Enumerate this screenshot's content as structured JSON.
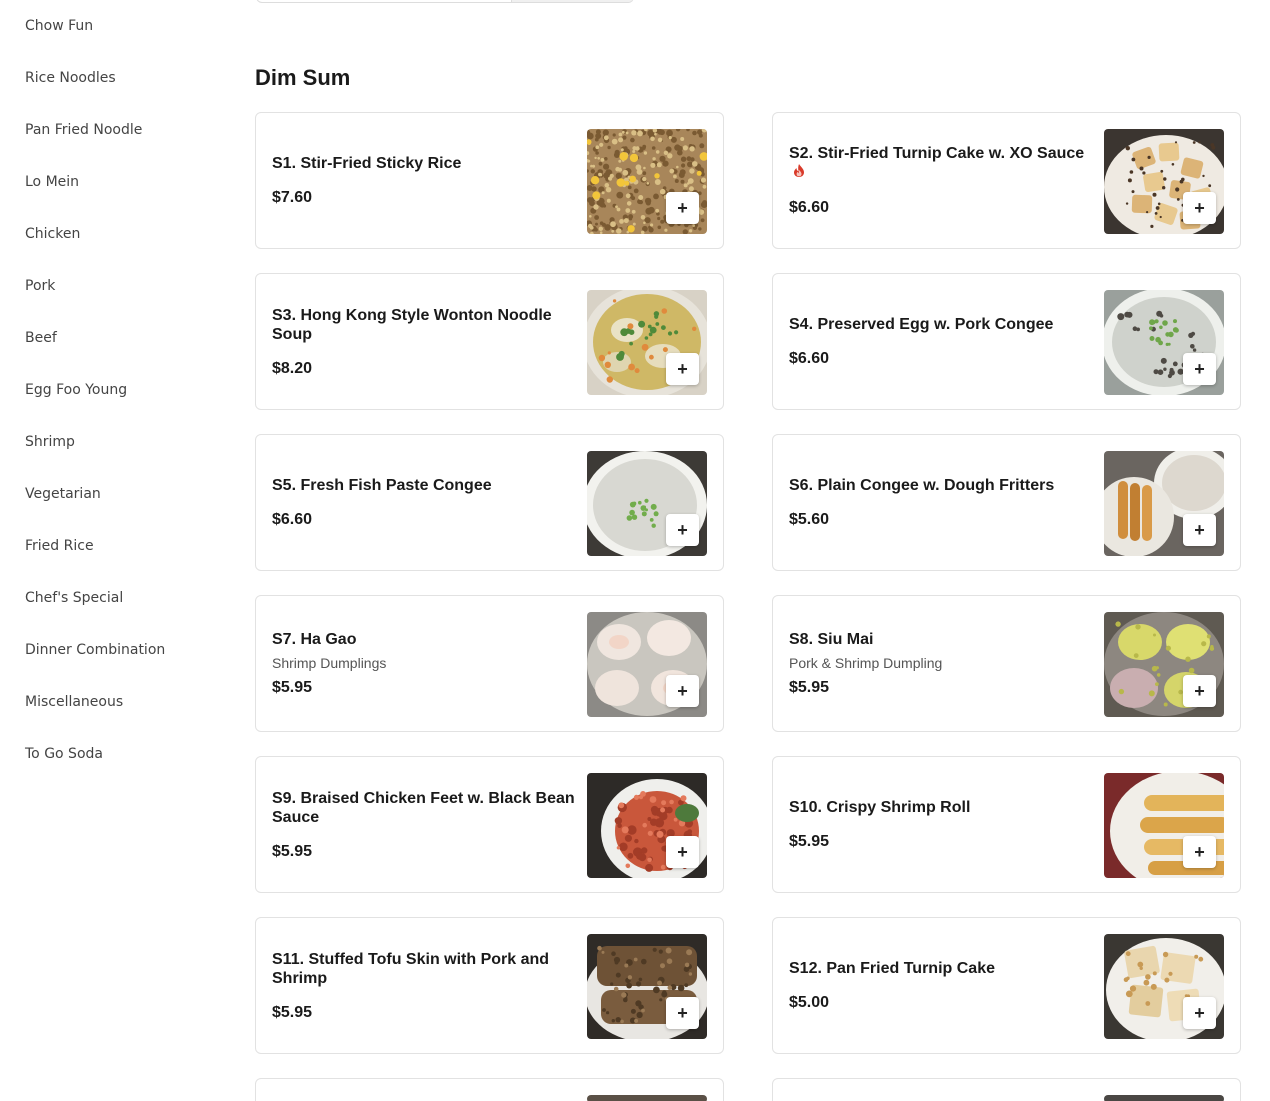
{
  "sidebar": {
    "items": [
      {
        "label": "Chow Fun"
      },
      {
        "label": "Rice Noodles"
      },
      {
        "label": "Pan Fried Noodle"
      },
      {
        "label": "Lo Mein"
      },
      {
        "label": "Chicken"
      },
      {
        "label": "Pork"
      },
      {
        "label": "Beef"
      },
      {
        "label": "Egg Foo Young"
      },
      {
        "label": "Shrimp"
      },
      {
        "label": "Vegetarian"
      },
      {
        "label": "Fried Rice"
      },
      {
        "label": "Chef's Special"
      },
      {
        "label": "Dinner Combination"
      },
      {
        "label": "Miscellaneous"
      },
      {
        "label": "To Go Soda"
      }
    ]
  },
  "section": {
    "title": "Dim Sum"
  },
  "add_icon": "plus-icon",
  "add_glyph": "+",
  "items": [
    {
      "name": "S1. Stir-Fried Sticky Rice",
      "price": "$7.60",
      "desc": "",
      "spicy": false,
      "photo": "sticky-rice"
    },
    {
      "name": "S2. Stir-Fried Turnip Cake w. XO Sauce",
      "price": "$6.60",
      "desc": "",
      "spicy": true,
      "photo": "turnip-cake-xo"
    },
    {
      "name": "S3. Hong Kong Style Wonton Noodle Soup",
      "price": "$8.20",
      "desc": "",
      "spicy": false,
      "photo": "wonton-soup"
    },
    {
      "name": "S4. Preserved Egg w. Pork Congee",
      "price": "$6.60",
      "desc": "",
      "spicy": false,
      "photo": "congee-dark"
    },
    {
      "name": "S5. Fresh Fish Paste Congee",
      "price": "$6.60",
      "desc": "",
      "spicy": false,
      "photo": "congee-plain"
    },
    {
      "name": "S6. Plain Congee w. Dough Fritters",
      "price": "$5.60",
      "desc": "",
      "spicy": false,
      "photo": "fritters"
    },
    {
      "name": "S7. Ha Gao",
      "price": "$5.95",
      "desc": "Shrimp Dumplings",
      "spicy": false,
      "photo": "ha-gao"
    },
    {
      "name": "S8. Siu Mai",
      "price": "$5.95",
      "desc": "Pork & Shrimp Dumpling",
      "spicy": false,
      "photo": "siu-mai"
    },
    {
      "name": "S9. Braised Chicken Feet w. Black Bean Sauce",
      "price": "$5.95",
      "desc": "",
      "spicy": false,
      "photo": "chicken-feet"
    },
    {
      "name": "S10. Crispy Shrimp Roll",
      "price": "$5.95",
      "desc": "",
      "spicy": false,
      "photo": "shrimp-roll"
    },
    {
      "name": "S11. Stuffed Tofu Skin with Pork and Shrimp",
      "price": "$5.95",
      "desc": "",
      "spicy": false,
      "photo": "tofu-skin"
    },
    {
      "name": "S12. Pan Fried Turnip Cake",
      "price": "$5.00",
      "desc": "",
      "spicy": false,
      "photo": "pan-fried-turnip"
    }
  ],
  "colors": {
    "border": "#e2e2e2",
    "sidebar_text": "#444444",
    "spicy": "#d93b2b"
  }
}
